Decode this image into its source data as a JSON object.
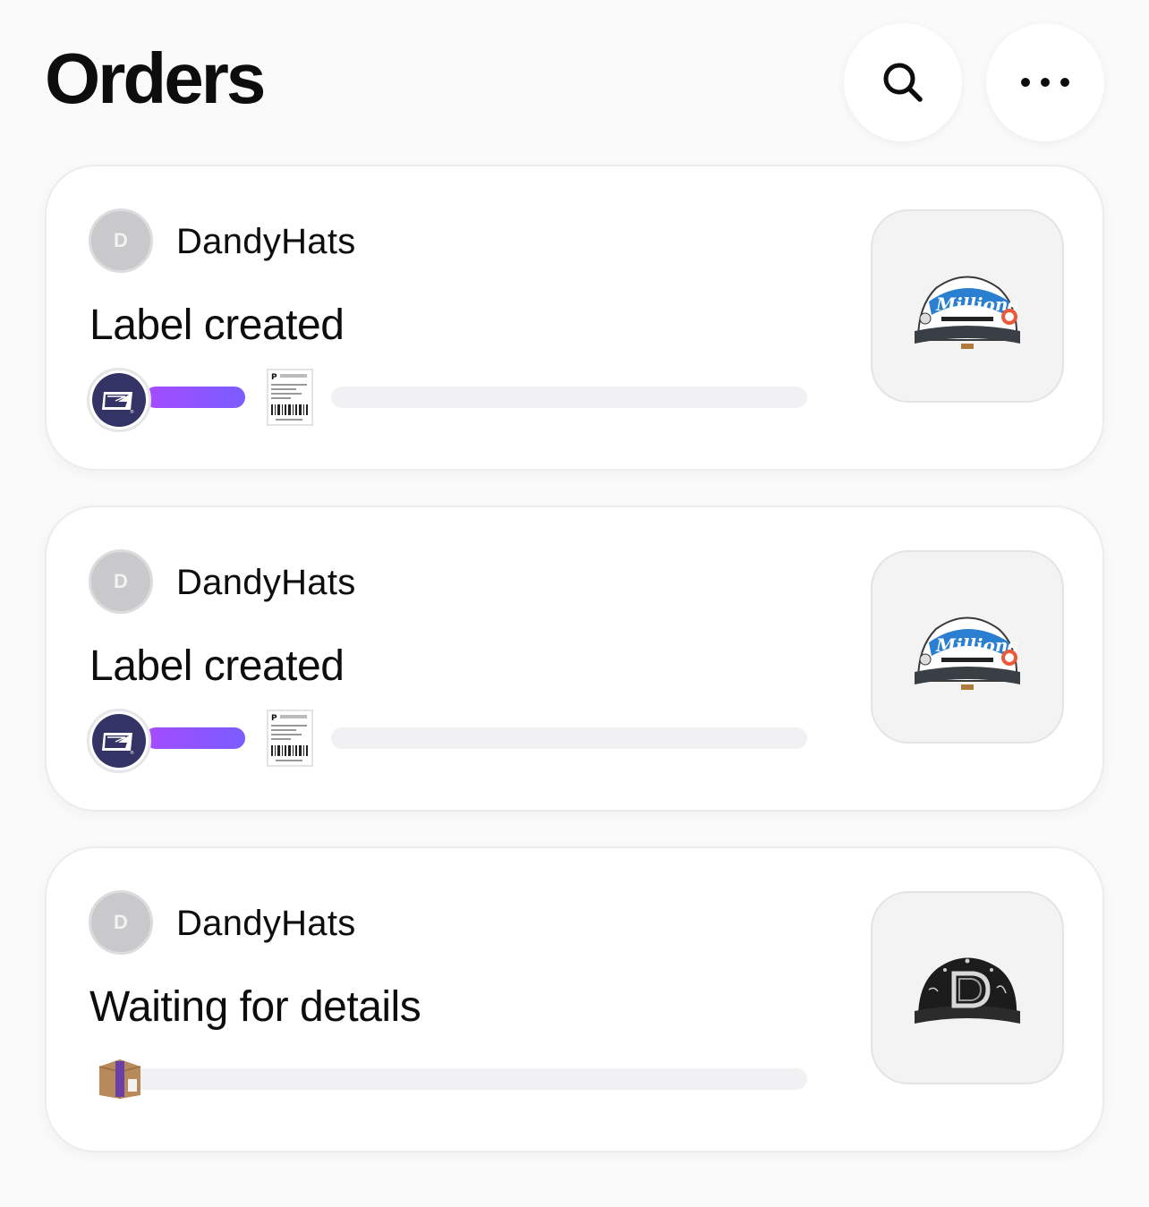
{
  "header": {
    "title": "Orders",
    "search_icon": "search-icon",
    "more_icon": "more-horizontal-icon"
  },
  "orders": [
    {
      "avatar_initial": "D",
      "store": "DandyHats",
      "status": "Label created",
      "carrier_icon": "usps-eagle-icon",
      "progress_icon": "shipping-label-icon",
      "product_image": "millions-trucker-hat"
    },
    {
      "avatar_initial": "D",
      "store": "DandyHats",
      "status": "Label created",
      "carrier_icon": "usps-eagle-icon",
      "progress_icon": "shipping-label-icon",
      "product_image": "millions-trucker-hat"
    },
    {
      "avatar_initial": "D",
      "store": "DandyHats",
      "status": "Waiting for details",
      "progress_icon": "package-box-icon",
      "product_image": "black-d-logo-cap"
    }
  ],
  "colors": {
    "accent_gradient_start": "#a54cff",
    "accent_gradient_end": "#7a5cff",
    "usps_navy": "#333366",
    "track": "#f1f1f3"
  }
}
